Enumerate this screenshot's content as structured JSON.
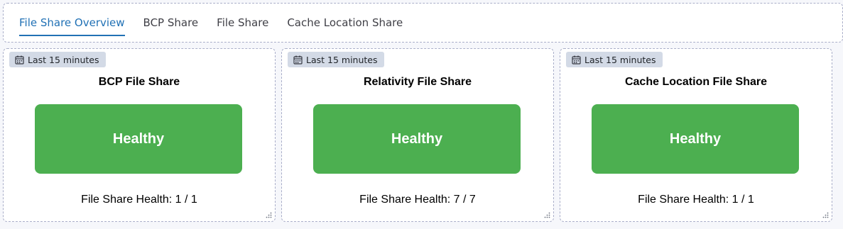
{
  "tabs": [
    {
      "label": "File Share Overview",
      "active": true
    },
    {
      "label": "BCP Share",
      "active": false
    },
    {
      "label": "File Share",
      "active": false
    },
    {
      "label": "Cache Location Share",
      "active": false
    }
  ],
  "colors": {
    "accent": "#2171b5",
    "healthy": "#4caf50",
    "badge_bg": "#d3dae6"
  },
  "panels": [
    {
      "time_range": "Last 15 minutes",
      "title": "BCP File Share",
      "status": "Healthy",
      "health_metric": "File Share Health: 1 / 1"
    },
    {
      "time_range": "Last 15 minutes",
      "title": "Relativity File Share",
      "status": "Healthy",
      "health_metric": "File Share Health: 7 / 7"
    },
    {
      "time_range": "Last 15 minutes",
      "title": "Cache Location File Share",
      "status": "Healthy",
      "health_metric": "File Share Health: 1 / 1"
    }
  ],
  "icons": {
    "time_badge": "calendar-icon",
    "panel_corner": "resize-handle-icon"
  }
}
